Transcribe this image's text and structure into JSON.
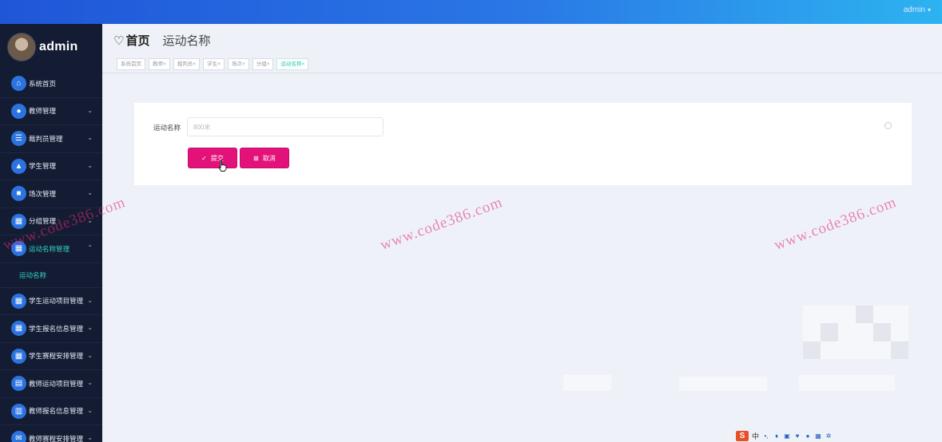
{
  "topbar": {
    "user_label": "admin",
    "caret": "▾"
  },
  "sidebar": {
    "brand_name": "admin",
    "items": [
      {
        "label": "系统首页",
        "icon": "home-icon",
        "glyph": "⌂",
        "has_caret": false
      },
      {
        "label": "教师管理",
        "icon": "user-icon",
        "glyph": "●",
        "has_caret": true
      },
      {
        "label": "裁判员管理",
        "icon": "list-icon",
        "glyph": "☰",
        "has_caret": true
      },
      {
        "label": "学生管理",
        "icon": "student-icon",
        "glyph": "▲",
        "has_caret": true
      },
      {
        "label": "场次管理",
        "icon": "session-icon",
        "glyph": "■",
        "has_caret": true
      },
      {
        "label": "分组管理",
        "icon": "grid-icon",
        "glyph": "▦",
        "has_caret": true
      },
      {
        "label": "运动名称管理",
        "icon": "grid-icon",
        "glyph": "▦",
        "has_caret": true,
        "open": true,
        "submenu": [
          "运动名称"
        ]
      },
      {
        "label": "学生运动项目管理",
        "icon": "grid-icon",
        "glyph": "▦",
        "has_caret": true
      },
      {
        "label": "学生报名信息管理",
        "icon": "grid-icon",
        "glyph": "▦",
        "has_caret": true
      },
      {
        "label": "学生赛程安排管理",
        "icon": "grid-icon",
        "glyph": "▦",
        "has_caret": true
      },
      {
        "label": "教师运动项目管理",
        "icon": "doc-icon",
        "glyph": "▤",
        "has_caret": true
      },
      {
        "label": "教师报名信息管理",
        "icon": "chart-icon",
        "glyph": "▥",
        "has_caret": true
      },
      {
        "label": "教师赛程安排管理",
        "icon": "mail-icon",
        "glyph": "✉",
        "has_caret": true
      }
    ],
    "caret_glyph": "⌄",
    "caret_up_glyph": "⌃"
  },
  "header": {
    "heart_glyph": "♡",
    "home": "首页",
    "current": "运动名称",
    "tags": [
      {
        "label": "系统首页",
        "active": false
      },
      {
        "label": "教师×",
        "active": false
      },
      {
        "label": "裁判员×",
        "active": false
      },
      {
        "label": "学生×",
        "active": false
      },
      {
        "label": "场次×",
        "active": false
      },
      {
        "label": "分组×",
        "active": false
      },
      {
        "label": "运动名称×",
        "active": true
      }
    ]
  },
  "form": {
    "label": "运动名称",
    "input_placeholder": "800米",
    "submit_label": "提交",
    "submit_icon": "✓",
    "cancel_label": "取消",
    "cancel_icon": "⊠"
  },
  "watermarks": [
    "www.code386.com",
    "www.code386.com",
    "www.code386.com"
  ],
  "ime": {
    "logo": "S",
    "lang": "中"
  },
  "colors": {
    "accent": "#e3127b",
    "sidebar_bg": "#141c33",
    "icon_blue": "#2b73e0",
    "active_teal": "#2fd5c5"
  }
}
